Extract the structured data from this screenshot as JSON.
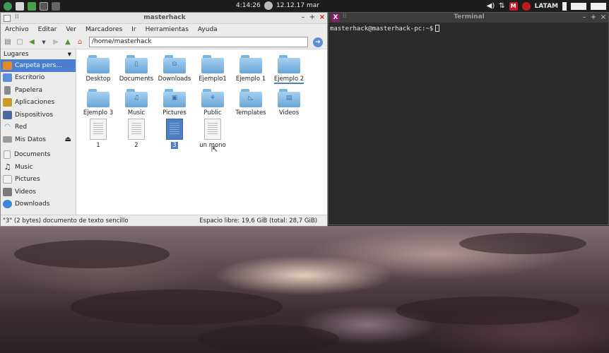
{
  "panel": {
    "clock": "4:14:26",
    "date": "12.12.17 mar",
    "keyboard": "LATAM",
    "mega_label": "M"
  },
  "file_manager": {
    "title": "masterhack",
    "menu": [
      "Archivo",
      "Editar",
      "Ver",
      "Marcadores",
      "Ir",
      "Herramientas",
      "Ayuda"
    ],
    "location": "/home/masterhack",
    "sidebar_header": "Lugares",
    "places": [
      {
        "label": "Carpeta pers...",
        "icon": "home-icon",
        "color": "#e08a2a"
      },
      {
        "label": "Escritorio",
        "icon": "desktop-icon",
        "color": "#5b8ed6"
      },
      {
        "label": "Papelera",
        "icon": "trash-icon",
        "color": "#8a8a8a"
      },
      {
        "label": "Aplicaciones",
        "icon": "applications-icon",
        "color": "#c99a2a"
      },
      {
        "label": "Dispositivos",
        "icon": "devices-icon",
        "color": "#4a6aa0"
      },
      {
        "label": "Red",
        "icon": "network-icon",
        "color": "#4a90d0"
      },
      {
        "label": "Mis Datos",
        "icon": "drive-icon",
        "color": "#9a9a9a"
      }
    ],
    "bookmarks": [
      {
        "label": "Documents",
        "icon": "documents-icon",
        "color": "#dcdcdc"
      },
      {
        "label": "Music",
        "icon": "music-icon",
        "color": "#dcdcdc"
      },
      {
        "label": "Pictures",
        "icon": "pictures-icon",
        "color": "#dcdcdc"
      },
      {
        "label": "Videos",
        "icon": "videos-icon",
        "color": "#7a7a7a"
      },
      {
        "label": "Downloads",
        "icon": "downloads-icon",
        "color": "#3a8ad8"
      }
    ],
    "files": [
      {
        "name": "Desktop",
        "kind": "folder",
        "glyph": ""
      },
      {
        "name": "Documents",
        "kind": "folder",
        "glyph": "▯"
      },
      {
        "name": "Downloads",
        "kind": "folder",
        "glyph": "⊙"
      },
      {
        "name": "Ejemplo1",
        "kind": "folder",
        "glyph": ""
      },
      {
        "name": "Ejemplo 1",
        "kind": "folder",
        "glyph": ""
      },
      {
        "name": "Ejemplo 2",
        "kind": "folder",
        "glyph": "",
        "state": "underlined"
      },
      {
        "name": "Ejemplo 3",
        "kind": "folder",
        "glyph": ""
      },
      {
        "name": "Music",
        "kind": "folder",
        "glyph": "♫"
      },
      {
        "name": "Pictures",
        "kind": "folder",
        "glyph": "▣"
      },
      {
        "name": "Public",
        "kind": "folder",
        "glyph": "⚘"
      },
      {
        "name": "Templates",
        "kind": "folder",
        "glyph": "◺"
      },
      {
        "name": "Videos",
        "kind": "folder",
        "glyph": "▤"
      },
      {
        "name": "1",
        "kind": "document"
      },
      {
        "name": "2",
        "kind": "document"
      },
      {
        "name": "3",
        "kind": "document",
        "state": "selected"
      },
      {
        "name": "un mono",
        "kind": "document"
      }
    ],
    "status_left": "\"3\" (2 bytes) documento de texto sencillo",
    "status_right": "Espacio libre: 19,6 GiB (total: 28,7 GiB)"
  },
  "terminal": {
    "title": "Terminal",
    "prompt": "masterhack@masterhack-pc:~$"
  }
}
